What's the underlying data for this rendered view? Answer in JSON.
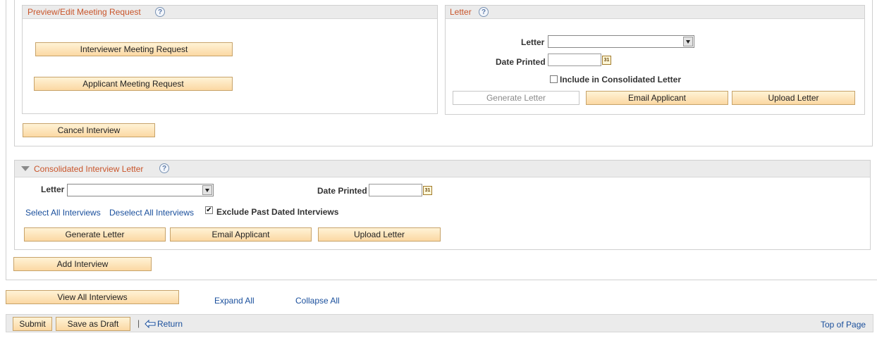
{
  "preview_panel": {
    "title": "Preview/Edit Meeting Request",
    "interviewer_button": "Interviewer Meeting Request",
    "applicant_button": "Applicant Meeting Request"
  },
  "letter_panel": {
    "title": "Letter",
    "letter_label": "Letter",
    "letter_value": "",
    "date_printed_label": "Date Printed",
    "date_printed_value": "",
    "include_checkbox_label": "Include in Consolidated Letter",
    "include_checked": false,
    "generate_button": "Generate Letter",
    "email_button": "Email Applicant",
    "upload_button": "Upload Letter"
  },
  "cancel_button": "Cancel Interview",
  "consolidated": {
    "title": "Consolidated Interview Letter",
    "letter_label": "Letter",
    "letter_value": "",
    "date_printed_label": "Date Printed",
    "date_printed_value": "",
    "select_all_link": "Select All Interviews",
    "deselect_all_link": "Deselect All Interviews",
    "exclude_checkbox_label": "Exclude Past Dated Interviews",
    "exclude_checked": true,
    "generate_button": "Generate Letter",
    "email_button": "Email Applicant",
    "upload_button": "Upload Letter"
  },
  "add_interview_button": "Add Interview",
  "view_all_button": "View All Interviews",
  "expand_all_link": "Expand All",
  "collapse_all_link": "Collapse All",
  "footer": {
    "submit_button": "Submit",
    "save_draft_button": "Save as Draft",
    "separator": "|",
    "return_link": "Return",
    "top_of_page_link": "Top of Page"
  },
  "icons": {
    "help": "?",
    "calendar": "31",
    "check": "✔"
  },
  "colors": {
    "section_title": "#c9552b",
    "link": "#1a4f9c",
    "button_bg": "#fbd8a3"
  }
}
